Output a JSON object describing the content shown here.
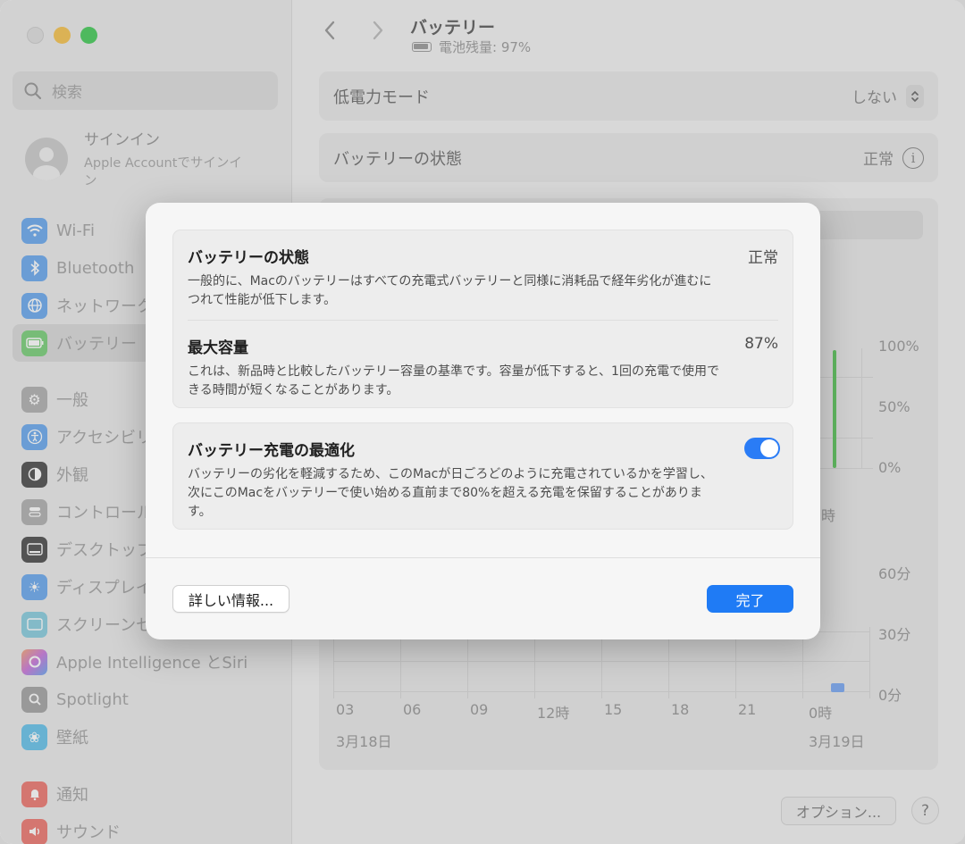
{
  "sidebar": {
    "search_placeholder": "検索",
    "account_title": "サインイン",
    "account_subtitle": "Apple Accountでサインイン",
    "items": [
      {
        "label": "Wi-Fi",
        "icon": "wifi-icon",
        "color": "#3b8df2"
      },
      {
        "label": "Bluetooth",
        "icon": "bluetooth-icon",
        "color": "#3b8df2"
      },
      {
        "label": "ネットワーク",
        "icon": "globe-icon",
        "color": "#3b8df2"
      },
      {
        "label": "バッテリー",
        "icon": "battery-icon",
        "color": "#4cc24c"
      },
      {
        "label": "一般",
        "icon": "gear-icon",
        "color": "#9a9a9a"
      },
      {
        "label": "アクセシビリティ",
        "icon": "accessibility-icon",
        "color": "#3b8df2"
      },
      {
        "label": "外観",
        "icon": "appearance-icon",
        "color": "#222222"
      },
      {
        "label": "コントロールセンター",
        "icon": "control-center-icon",
        "color": "#9a9a9a"
      },
      {
        "label": "デスクトップとDock",
        "icon": "dock-icon",
        "color": "#222222"
      },
      {
        "label": "ディスプレイ",
        "icon": "display-icon",
        "color": "#3b8df2"
      },
      {
        "label": "スクリーンセーバ",
        "icon": "screensaver-icon",
        "color": "#6ec3d8"
      },
      {
        "label": "Apple Intelligence とSiri",
        "icon": "siri-icon",
        "color": "#c46ad8"
      },
      {
        "label": "Spotlight",
        "icon": "spotlight-icon",
        "color": "#8a8a8a"
      },
      {
        "label": "壁紙",
        "icon": "wallpaper-icon",
        "color": "#3bb0e8"
      },
      {
        "label": "通知",
        "icon": "bell-icon",
        "color": "#e8453c"
      },
      {
        "label": "サウンド",
        "icon": "sound-icon",
        "color": "#e8453c"
      }
    ]
  },
  "header": {
    "title": "バッテリー",
    "subtitle": "電池残量: 97%"
  },
  "settings": {
    "low_power_label": "低電力モード",
    "low_power_value": "しない",
    "health_label": "バッテリーの状態",
    "health_value": "正常"
  },
  "chart": {
    "pct_labels": [
      "100%",
      "50%",
      "0%"
    ],
    "time_tick": "時",
    "min_labels": [
      "60分",
      "30分",
      "0分"
    ],
    "x_ticks": [
      "03",
      "06",
      "09",
      "12時",
      "15",
      "18",
      "21",
      "0時"
    ],
    "date_left": "3月18日",
    "date_right": "3月19日"
  },
  "footer": {
    "options_label": "オプション...",
    "help_label": "?"
  },
  "modal": {
    "health_title": "バッテリーの状態",
    "health_value": "正常",
    "health_desc": "一般的に、Macのバッテリーはすべての充電式バッテリーと同様に消耗品で経年劣化が進むにつれて性能が低下します。",
    "capacity_title": "最大容量",
    "capacity_value": "87%",
    "capacity_desc": "これは、新品時と比較したバッテリー容量の基準です。容量が低下すると、1回の充電で使用できる時間が短くなることがあります。",
    "optimize_title": "バッテリー充電の最適化",
    "optimize_on": true,
    "optimize_desc": "バッテリーの劣化を軽減するため、このMacが日ごろどのように充電されているかを学習し、次にこのMacをバッテリーで使い始める直前まで80%を超える充電を保留することがあります。",
    "details_button": "詳しい情報...",
    "done_button": "完了"
  },
  "colors": {
    "accent": "#1f7bf5",
    "battery_green": "#4cc24c"
  }
}
